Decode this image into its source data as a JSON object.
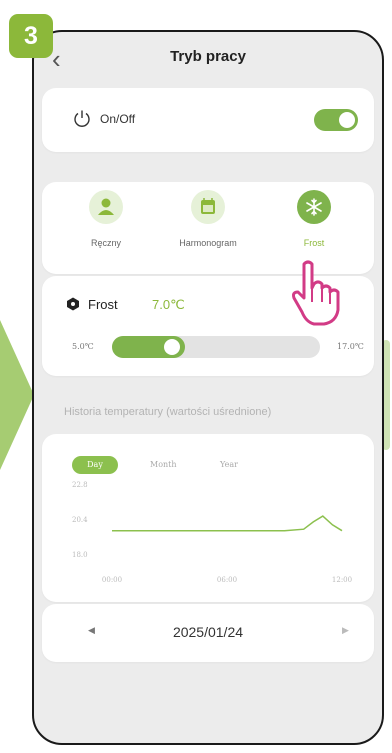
{
  "step": {
    "number": "3"
  },
  "header": {
    "title": "Tryb pracy",
    "back_icon": "chevron-left-icon"
  },
  "onoff": {
    "label": "On/Off",
    "state": "on",
    "icon": "power-icon"
  },
  "modes": [
    {
      "label": "Ręczny",
      "icon": "person-icon",
      "active": false
    },
    {
      "label": "Harmonogram",
      "icon": "calendar-icon",
      "active": false
    },
    {
      "label": "Frost",
      "icon": "snowflake-icon",
      "active": true
    }
  ],
  "frost": {
    "title": "Frost",
    "value": "7.0℃",
    "min_label": "5.0℃",
    "max_label": "17.0℃",
    "level": 7.0,
    "min": 5.0,
    "max": 17.0
  },
  "history": {
    "title": "Historia temperatury (wartości uśrednione)",
    "tabs": [
      {
        "label": "Day",
        "active": true
      },
      {
        "label": "Month",
        "active": false
      },
      {
        "label": "Year",
        "active": false
      }
    ]
  },
  "chart_data": {
    "type": "line",
    "title": "",
    "xlabel": "",
    "ylabel": "",
    "x_ticks": [
      "00:00",
      "06:00",
      "12:00"
    ],
    "y_ticks": [
      "22.8",
      "20.4",
      "18.0"
    ],
    "ylim": [
      18.0,
      22.8
    ],
    "series": [
      {
        "x": [
          0,
          1,
          2,
          3,
          4,
          5,
          6,
          7,
          8,
          9,
          10,
          10.5,
          11,
          11.5,
          12
        ],
        "values": [
          19.6,
          19.6,
          19.6,
          19.6,
          19.6,
          19.6,
          19.6,
          19.6,
          19.6,
          19.6,
          19.7,
          20.2,
          20.6,
          20.0,
          19.6
        ]
      }
    ],
    "grid": false,
    "colors": {
      "line": "#8cc04e"
    }
  },
  "date_nav": {
    "date": "2025/01/24",
    "prev": "◀",
    "next": "▶"
  },
  "colors": {
    "accent": "#8cb83a",
    "toggle": "#7fb34c",
    "background": "#ececec"
  }
}
